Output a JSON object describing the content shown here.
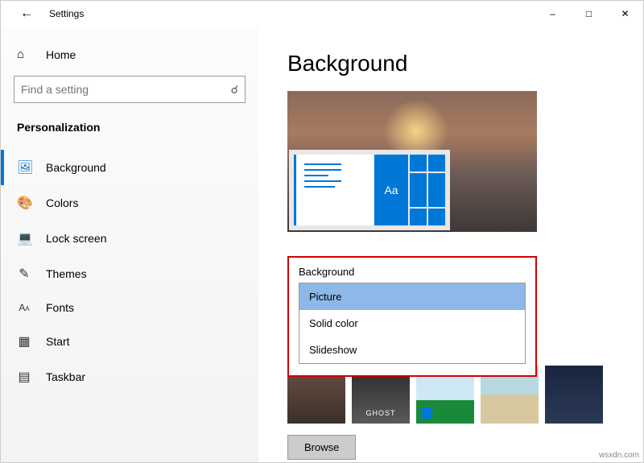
{
  "titlebar": {
    "title": "Settings"
  },
  "sidebar": {
    "home_label": "Home",
    "search_placeholder": "Find a setting",
    "group_title": "Personalization",
    "items": [
      {
        "label": "Background"
      },
      {
        "label": "Colors"
      },
      {
        "label": "Lock screen"
      },
      {
        "label": "Themes"
      },
      {
        "label": "Fonts"
      },
      {
        "label": "Start"
      },
      {
        "label": "Taskbar"
      }
    ]
  },
  "main": {
    "heading": "Background",
    "preview_sample_text": "Aa",
    "dropdown": {
      "label": "Background",
      "options": [
        {
          "label": "Picture",
          "selected": true
        },
        {
          "label": "Solid color",
          "selected": false
        },
        {
          "label": "Slideshow",
          "selected": false
        }
      ]
    },
    "browse_label": "Browse"
  },
  "watermark": "wsxdn.com"
}
